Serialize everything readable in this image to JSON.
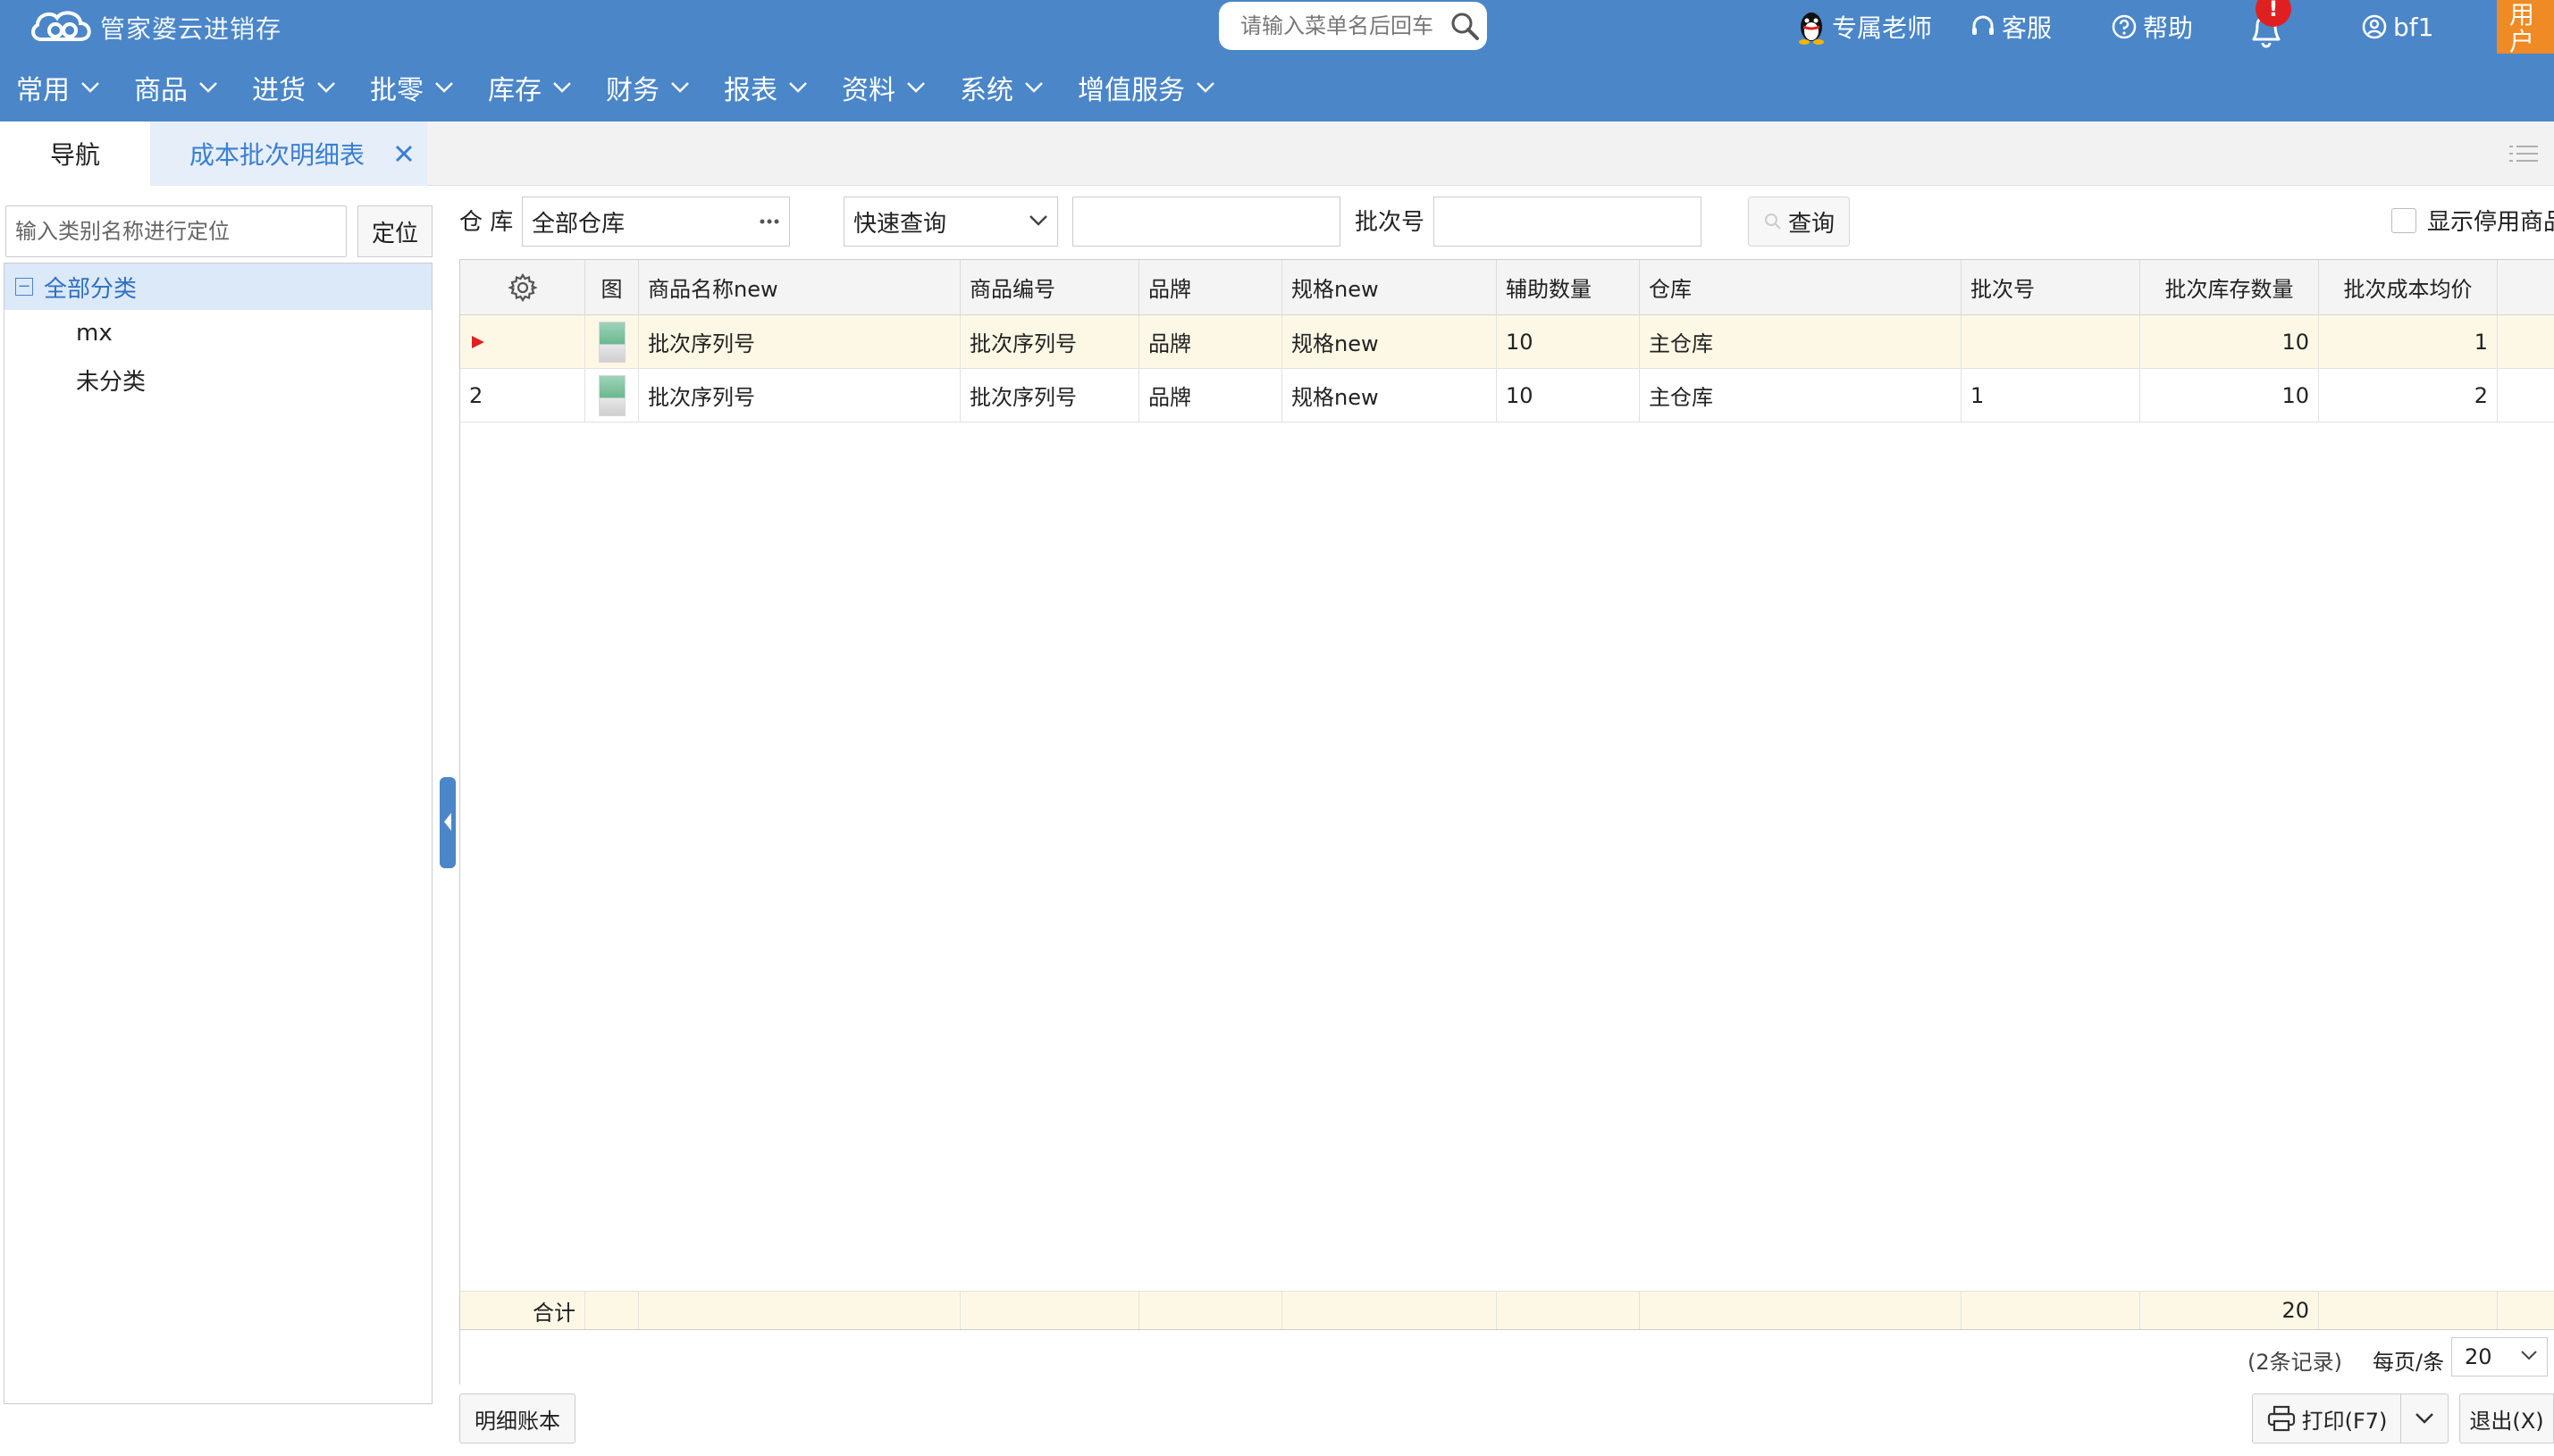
{
  "app": {
    "logo_text": "管家婆云进销存"
  },
  "topbar": {
    "search_placeholder": "请输入菜单名后回车",
    "links": {
      "teacher": "专属老师",
      "service": "客服",
      "help": "帮助"
    },
    "notification_badge": "!",
    "username": "bf1",
    "user_interact": "用户互动"
  },
  "menu": {
    "items": [
      "常用",
      "商品",
      "进货",
      "批零",
      "库存",
      "财务",
      "报表",
      "资料",
      "系统",
      "增值服务"
    ]
  },
  "tabs": {
    "nav": "导航",
    "active": "成本批次明细表"
  },
  "left": {
    "search_placeholder": "输入类别名称进行定位",
    "locate_label": "定位",
    "tree_root": "全部分类",
    "tree_children": [
      "mx",
      "未分类"
    ]
  },
  "filters": {
    "warehouse_label": "仓 库",
    "warehouse_value": "全部仓库",
    "quick_query": "快速查询",
    "batch_label": "批次号",
    "query_button": "查询",
    "show_disabled": "显示停用商品"
  },
  "grid": {
    "headers": {
      "img": "图",
      "name": "商品名称new",
      "code": "商品编号",
      "brand": "品牌",
      "spec": "规格new",
      "aux_qty": "辅助数量",
      "warehouse": "仓库",
      "batch": "批次号",
      "stock_qty": "批次库存数量",
      "avg_cost": "批次成本均价"
    },
    "rows": [
      {
        "index": "",
        "name": "批次序列号",
        "code": "批次序列号",
        "brand": "品牌",
        "spec": "规格new",
        "aux_qty": "10",
        "warehouse": "主仓库",
        "batch": "",
        "stock_qty": "10",
        "avg_cost": "1"
      },
      {
        "index": "2",
        "name": "批次序列号",
        "code": "批次序列号",
        "brand": "品牌",
        "spec": "规格new",
        "aux_qty": "10",
        "warehouse": "主仓库",
        "batch": "1",
        "stock_qty": "10",
        "avg_cost": "2"
      }
    ],
    "total_label": "合计",
    "total_stock_qty": "20",
    "records": "(2条记录)",
    "per_page_label": "每页/条",
    "per_page_value": "20"
  },
  "footer": {
    "detail_button": "明细账本",
    "print_button": "打印(F7)",
    "exit_button": "退出(X)"
  },
  "colors": {
    "header_blue": "#4a86c8",
    "tab_active_text": "#3a7fd3",
    "selected_row": "#fdf8e6",
    "user_interact_orange": "#f08a24",
    "badge_red": "#e02020"
  }
}
